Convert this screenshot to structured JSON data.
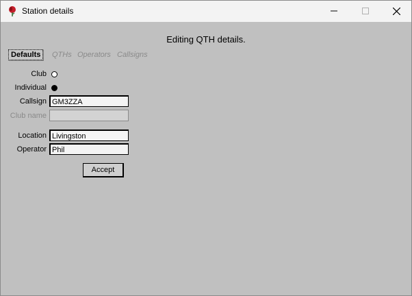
{
  "window": {
    "title": "Station details"
  },
  "form": {
    "heading": "Editing QTH details.",
    "tabs": [
      "Defaults",
      "QTHs",
      "Operators",
      "Callsigns"
    ],
    "active_tab": "Defaults",
    "club_label": "Club",
    "individual_label": "Individual",
    "station_type_selected": "Individual",
    "callsign_label": "Callsign",
    "callsign_value": "GM3ZZA",
    "club_name_label": "Club name",
    "club_name_value": "",
    "location_label": "Location",
    "location_value": "Livingston",
    "operator_label": "Operator",
    "operator_value": "Phil",
    "accept_label": "Accept"
  },
  "colors": {
    "background": "#c0c0c0",
    "titlebar": "#f3f3f3",
    "disabled_text": "#8a8a8a",
    "app_icon": "#c41e2a"
  },
  "icons": {
    "app": "red-rose-icon",
    "minimize": "minimize-icon",
    "maximize": "maximize-icon",
    "close": "close-icon"
  }
}
